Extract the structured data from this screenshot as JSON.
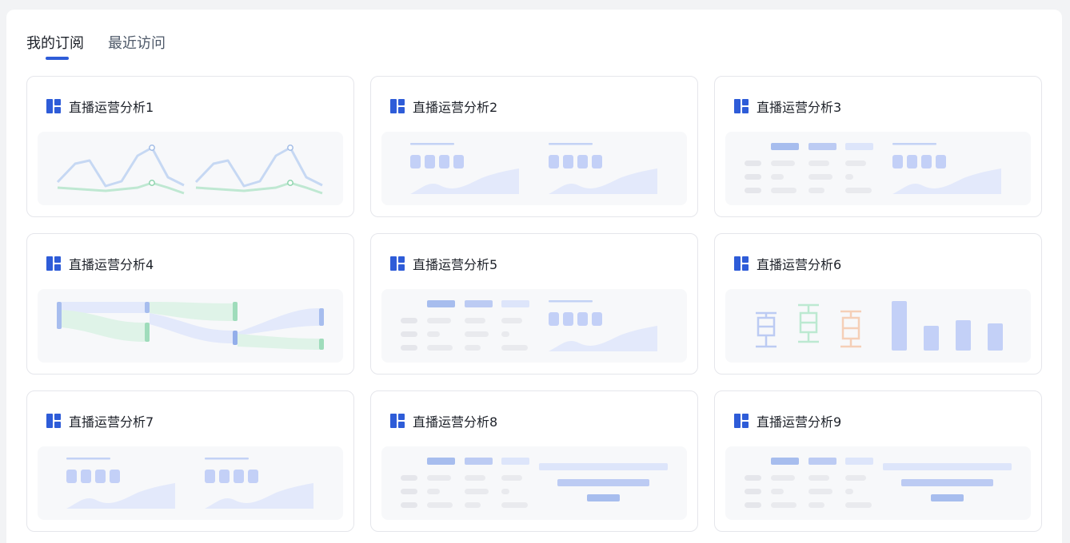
{
  "tabs": {
    "subscriptions": "我的订阅",
    "recent": "最近访问"
  },
  "colors": {
    "accent": "#2e5cd8",
    "thumbnail_blue": "#b9c9f3",
    "thumbnail_green": "#a9e0c2",
    "thumbnail_orange": "#f5cfb7"
  },
  "cards": [
    {
      "title": "直播运营分析1",
      "icon": "dashboard-icon",
      "thumbnail": "line-chart-preview"
    },
    {
      "title": "直播运营分析2",
      "icon": "dashboard-icon",
      "thumbnail": "kpi-area-preview"
    },
    {
      "title": "直播运营分析3",
      "icon": "dashboard-icon",
      "thumbnail": "table-kpi-preview"
    },
    {
      "title": "直播运营分析4",
      "icon": "dashboard-icon",
      "thumbnail": "sankey-preview"
    },
    {
      "title": "直播运营分析5",
      "icon": "dashboard-icon",
      "thumbnail": "table-kpi-preview"
    },
    {
      "title": "直播运营分析6",
      "icon": "dashboard-icon",
      "thumbnail": "boxplot-bar-preview"
    },
    {
      "title": "直播运营分析7",
      "icon": "dashboard-icon",
      "thumbnail": "kpi-area-preview"
    },
    {
      "title": "直播运营分析8",
      "icon": "dashboard-icon",
      "thumbnail": "table-funnel-preview"
    },
    {
      "title": "直播运营分析9",
      "icon": "dashboard-icon",
      "thumbnail": "table-funnel-preview"
    }
  ]
}
